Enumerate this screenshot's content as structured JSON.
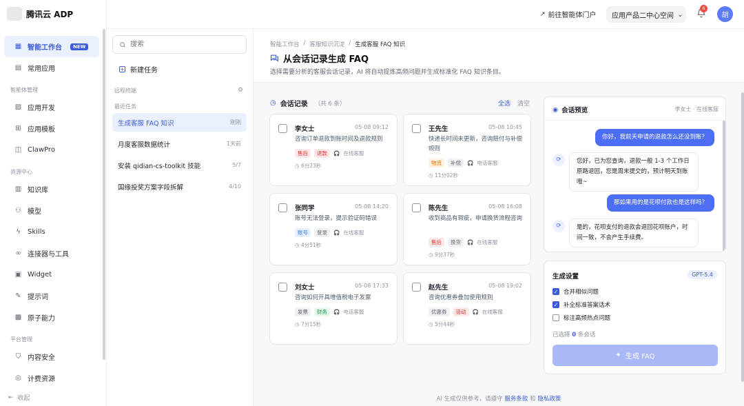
{
  "brand": {
    "name": "腾讯云 ADP"
  },
  "topbar": {
    "portal": "前往智能体门户",
    "space": "应用产品二中心空间",
    "notifications": "6",
    "avatar": "胡"
  },
  "sidebar": {
    "items": [
      {
        "label": "智能工作台",
        "icon": "grid-icon",
        "badge": "NEW"
      },
      {
        "label": "常用应用",
        "icon": "apps-icon"
      },
      {
        "group": "智能体管理"
      },
      {
        "label": "应用开发",
        "icon": "dev-icon"
      },
      {
        "label": "应用模板",
        "icon": "template-icon"
      },
      {
        "label": "ClawPro",
        "icon": "robot-icon"
      },
      {
        "group": "资源中心"
      },
      {
        "label": "知识库",
        "icon": "book-icon"
      },
      {
        "label": "模型",
        "icon": "model-icon"
      },
      {
        "label": "Skills",
        "icon": "bolt-icon"
      },
      {
        "label": "连接器与工具",
        "icon": "link-icon"
      },
      {
        "label": "Widget",
        "icon": "widget-icon"
      },
      {
        "label": "提示词",
        "icon": "pen-icon"
      },
      {
        "label": "原子能力",
        "icon": "chip-icon"
      },
      {
        "group": "平台管理"
      },
      {
        "label": "内容安全",
        "icon": "shield-icon"
      },
      {
        "label": "计费资源",
        "icon": "coin-icon"
      }
    ],
    "collapse": "收起"
  },
  "taskpanel": {
    "search_placeholder": "搜索",
    "new_task": "新建任务",
    "remote_label": "远程终端",
    "recent_label": "最近任务",
    "tasks": [
      {
        "name": "生成客服 FAQ 知识",
        "meta": "刚刚"
      },
      {
        "name": "月度客服数据统计",
        "meta": "1天前"
      },
      {
        "name": "安装 qidian-cs-toolkit 技能",
        "meta": "5/7"
      },
      {
        "name": "国缘投奖方案字段拆解",
        "meta": "4/10"
      }
    ]
  },
  "main": {
    "breadcrumb": [
      "智能工作台",
      "客服知识沉淀",
      "生成客服 FAQ 知识"
    ],
    "title": "从会话记录生成 FAQ",
    "desc": "选择需要分析的客服会话记录，AI 将自动提炼高频问题并生成标准化 FAQ 知识条目。",
    "sessions": {
      "title": "会话记录",
      "count": "（共 6 条）",
      "select_all": "全选",
      "clear": "清空",
      "cards": [
        {
          "name": "李女士",
          "time": "05-08 09:12",
          "desc": "咨询订单退款到账时间及退款规则",
          "tags": [
            {
              "t": "售后",
              "c": "red"
            },
            {
              "t": "退款",
              "c": "red"
            }
          ],
          "channel": "在线客服",
          "duration": "6分23秒"
        },
        {
          "name": "王先生",
          "time": "05-08 10:45",
          "desc": "快递长时间未更新，咨询赔付与补偿规则",
          "tags": [
            {
              "t": "物流",
              "c": "orange"
            },
            {
              "t": "补偿",
              "c": "gray"
            }
          ],
          "channel": "电话客服",
          "duration": "11分02秒"
        },
        {
          "name": "张同学",
          "time": "05-08 14:20",
          "desc": "账号无法登录，提示验证码错误",
          "tags": [
            {
              "t": "账号",
              "c": "blue"
            },
            {
              "t": "登录",
              "c": "gray"
            }
          ],
          "channel": "在线客服",
          "duration": "4分51秒"
        },
        {
          "name": "陈先生",
          "time": "05-08 16:08",
          "desc": "收到商品有瑕疵，申请换货流程咨询",
          "tags": [
            {
              "t": "售后",
              "c": "red"
            },
            {
              "t": "换货",
              "c": "gray"
            }
          ],
          "channel": "在线客服",
          "duration": "9分37秒"
        },
        {
          "name": "刘女士",
          "time": "05-08 17:33",
          "desc": "咨询如何开具增值税电子发票",
          "tags": [
            {
              "t": "发票",
              "c": "gray"
            },
            {
              "t": "财务",
              "c": "green"
            }
          ],
          "channel": "电话客服",
          "duration": "7分15秒"
        },
        {
          "name": "赵先生",
          "time": "05-08 19:02",
          "desc": "咨询优惠券叠加使用规则",
          "tags": [
            {
              "t": "优惠券",
              "c": "gray"
            },
            {
              "t": "活动",
              "c": "red"
            }
          ],
          "channel": "在线客服",
          "duration": "5分44秒"
        }
      ]
    },
    "preview": {
      "title": "会话预览",
      "user": "李女士 · 在线客服",
      "messages": [
        {
          "role": "user",
          "text": "你好，我前天申请的退款怎么还没到账？"
        },
        {
          "role": "bot",
          "text": "您好，已为您查询，退款一般 1-3 个工作日原路退回，您是周末提交的，预计明天到账哦~"
        },
        {
          "role": "user",
          "text": "那如果用的是花呗付款也是这样吗？"
        },
        {
          "role": "bot",
          "text": "是的，花呗支付的退款会退回花呗账户，时间一致，不会产生手续费。"
        }
      ]
    },
    "settings": {
      "title": "生成设置",
      "model": "GPT-5.4",
      "options": [
        {
          "label": "合并相似问题",
          "checked": true
        },
        {
          "label": "补全标准答案话术",
          "checked": true
        },
        {
          "label": "标注高频热点问题",
          "checked": false
        }
      ],
      "selected_prefix": "已选择",
      "selected_count": "0",
      "selected_suffix": "条会话",
      "generate": "生成 FAQ"
    },
    "footer": {
      "prefix": "AI 生成仅供参考，请遵守",
      "terms": "服务条款",
      "and": "和",
      "privacy": "隐私政策"
    }
  }
}
